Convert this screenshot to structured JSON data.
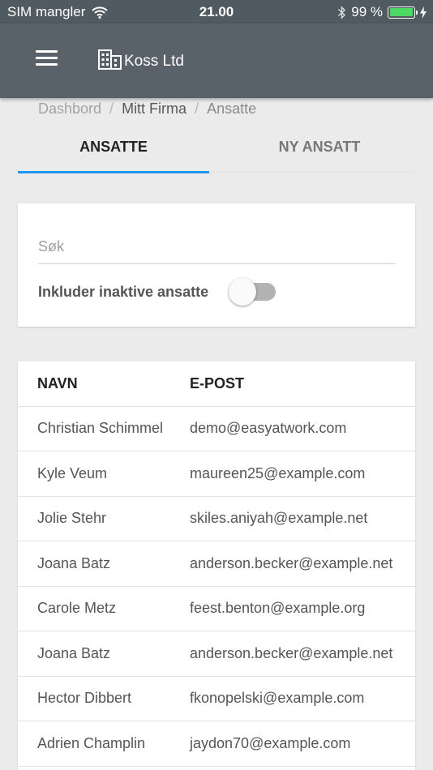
{
  "status_bar": {
    "carrier": "SIM mangler",
    "time": "21.00",
    "battery_percent": "99 %",
    "battery_level": 0.99,
    "icons": [
      "wifi-icon",
      "bluetooth-icon",
      "battery-icon",
      "charging-icon"
    ]
  },
  "app_bar": {
    "company_name": "Koss Ltd",
    "icons": [
      "hamburger-menu-icon",
      "building-icon"
    ]
  },
  "breadcrumb": [
    "Dashbord",
    "Mitt Firma",
    "Ansatte"
  ],
  "tabs": {
    "active": "ANSATTE",
    "inactive": "NY ANSATT"
  },
  "search": {
    "placeholder": "Søk",
    "value": "",
    "toggle_label": "Inkluder inaktive ansatte",
    "toggle_on": false
  },
  "table": {
    "headers": [
      "NAVN",
      "E-POST"
    ],
    "rows": [
      [
        "Christian Schimmel",
        "demo@easyatwork.com"
      ],
      [
        "Kyle Veum",
        "maureen25@example.com"
      ],
      [
        "Jolie Stehr",
        "skiles.aniyah@example.net"
      ],
      [
        "Joana Batz",
        "anderson.becker@example.net"
      ],
      [
        "Carole Metz",
        "feest.benton@example.org"
      ],
      [
        "Joana Batz",
        "anderson.becker@example.net"
      ],
      [
        "Hector Dibbert",
        "fkonopelski@example.com"
      ],
      [
        "Adrien Champlin",
        "jaydon70@example.com"
      ]
    ]
  },
  "colors": {
    "app_bar": "#596269",
    "status_bar": "#4f5a61",
    "accent": "#2196f3",
    "battery": "#4cd964",
    "background": "#ebebeb"
  }
}
